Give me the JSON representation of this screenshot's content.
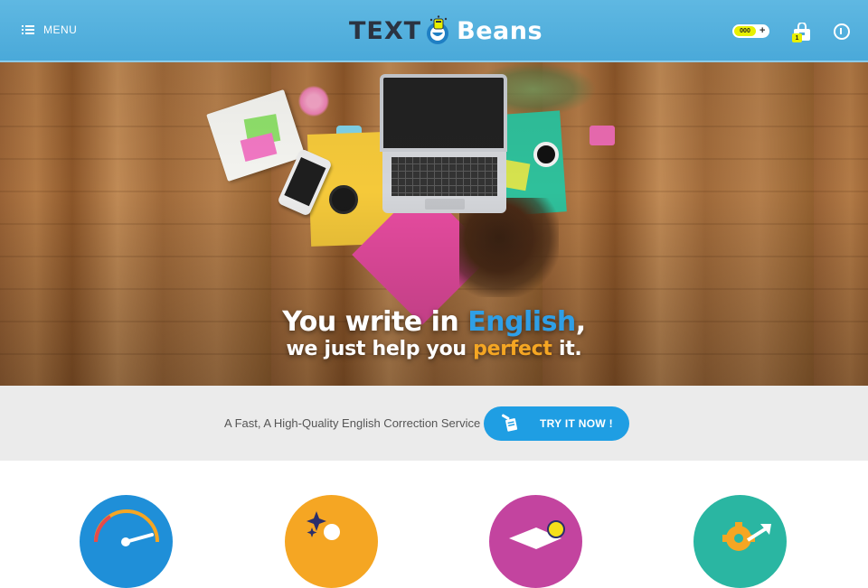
{
  "header": {
    "menu_label": "MENU",
    "logo_text_dark": "TEXT",
    "logo_text_light": "Beans",
    "credit_value": "000",
    "credit_add": "+",
    "cart_count": "1"
  },
  "hero": {
    "line1_prefix": "You write in ",
    "line1_highlight": "English",
    "line1_suffix": ",",
    "line2_prefix": "we just help you ",
    "line2_highlight": "perfect",
    "line2_suffix": " it."
  },
  "cta": {
    "tagline": "A Fast, A High-Quality English Correction Service",
    "button_label": "TRY IT NOW !"
  },
  "features": [
    {
      "icon": "speedometer-icon",
      "color": "#1f8fd8"
    },
    {
      "icon": "sparkle-star-icon",
      "color": "#f5a623"
    },
    {
      "icon": "graduation-cap-icon",
      "color": "#c3449f"
    },
    {
      "icon": "gear-growth-icon",
      "color": "#2ab6a2"
    }
  ],
  "colors": {
    "header_bg": "#4aa9d9",
    "accent_blue": "#1f9ee3",
    "accent_orange": "#f5a623",
    "badge_yellow": "#e8f000"
  }
}
